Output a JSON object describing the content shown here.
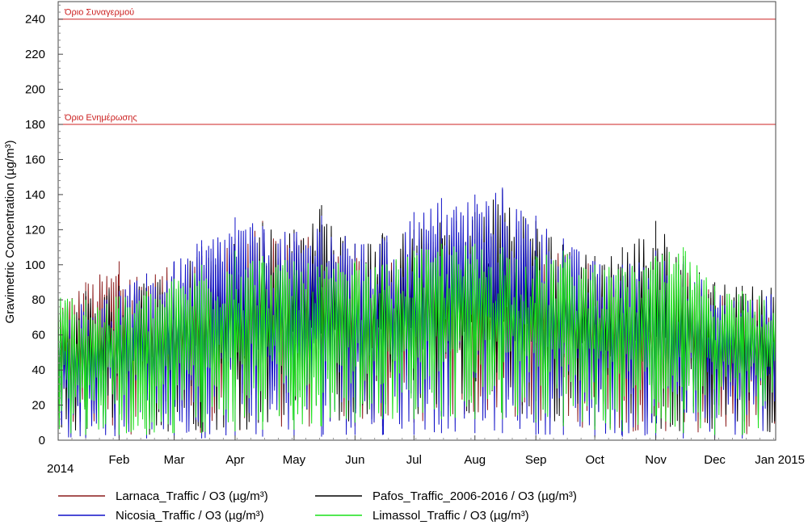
{
  "chart_data": {
    "type": "line",
    "title": "",
    "xlabel": "",
    "ylabel": "Gravimetric Concentration (µg/m³)",
    "ylim": [
      0,
      250
    ],
    "xlim": [
      "2014-01-01",
      "2015-01-01"
    ],
    "y_ticks": [
      0,
      20,
      40,
      60,
      80,
      100,
      120,
      140,
      160,
      180,
      200,
      220,
      240
    ],
    "x_ticks": [
      {
        "date": "2014-02-01",
        "label": "Feb"
      },
      {
        "date": "2014-03-01",
        "label": "Mar"
      },
      {
        "date": "2014-04-01",
        "label": "Apr"
      },
      {
        "date": "2014-05-01",
        "label": "May"
      },
      {
        "date": "2014-06-01",
        "label": "Jun"
      },
      {
        "date": "2014-07-01",
        "label": "Jul"
      },
      {
        "date": "2014-08-01",
        "label": "Aug"
      },
      {
        "date": "2014-09-01",
        "label": "Sep"
      },
      {
        "date": "2014-10-01",
        "label": "Oct"
      },
      {
        "date": "2014-11-01",
        "label": "Nov"
      },
      {
        "date": "2014-12-01",
        "label": "Dec"
      },
      {
        "date": "2015-01-01",
        "label": "Jan 2015"
      }
    ],
    "year_label": "2014",
    "grid": false,
    "legend_position": "bottom",
    "reference_lines": [
      {
        "value": 240,
        "label": "Όριο Συναγερμού",
        "color": "#cc2222"
      },
      {
        "value": 180,
        "label": "Όριο Ενημέρωσης",
        "color": "#cc2222"
      }
    ],
    "series": [
      {
        "name": "Larnaca_Traffic / O3 (µg/m³)",
        "color": "#8b1a1a",
        "x": [
          "2014-01-01",
          "2014-01-15",
          "2014-02-01",
          "2014-02-15",
          "2014-03-01",
          "2014-03-15",
          "2014-04-01",
          "2014-04-15",
          "2014-05-01",
          "2014-05-15",
          "2014-06-01",
          "2014-06-15",
          "2014-07-01",
          "2014-07-15",
          "2014-08-01",
          "2014-08-15",
          "2014-09-01",
          "2014-09-15",
          "2014-10-01",
          "2014-10-15",
          "2014-11-01",
          "2014-11-15",
          "2014-12-01",
          "2014-12-15",
          "2015-01-01"
        ],
        "max": [
          80,
          90,
          102,
          95,
          100,
          105,
          112,
          125,
          118,
          115,
          108,
          105,
          110,
          115,
          112,
          110,
          105,
          108,
          100,
          98,
          95,
          100,
          85,
          80,
          82
        ],
        "min": [
          2,
          3,
          3,
          3,
          3,
          4,
          5,
          6,
          6,
          6,
          8,
          8,
          10,
          12,
          12,
          12,
          10,
          8,
          6,
          5,
          4,
          4,
          3,
          3,
          3
        ]
      },
      {
        "name": "Pafos_Traffic_2006-2016 / O3 (µg/m³)",
        "color": "#000000",
        "x": [
          "2014-01-01",
          "2014-01-15",
          "2014-02-01",
          "2014-02-15",
          "2014-03-01",
          "2014-03-15",
          "2014-04-01",
          "2014-04-15",
          "2014-05-01",
          "2014-05-15",
          "2014-06-01",
          "2014-06-15",
          "2014-07-01",
          "2014-07-15",
          "2014-08-01",
          "2014-08-15",
          "2014-09-01",
          "2014-09-15",
          "2014-10-01",
          "2014-10-15",
          "2014-11-01",
          "2014-11-15",
          "2014-12-01",
          "2014-12-15",
          "2015-01-01"
        ],
        "max": [
          78,
          85,
          88,
          92,
          98,
          108,
          115,
          124,
          120,
          134,
          112,
          118,
          120,
          125,
          130,
          143,
          125,
          112,
          105,
          110,
          125,
          105,
          90,
          88,
          92
        ],
        "min": [
          2,
          2,
          3,
          3,
          4,
          4,
          5,
          6,
          6,
          8,
          10,
          12,
          12,
          15,
          15,
          15,
          12,
          10,
          8,
          6,
          5,
          4,
          3,
          3,
          3
        ]
      },
      {
        "name": "Nicosia_Traffic / O3 (µg/m³)",
        "color": "#1010c8",
        "x": [
          "2014-01-01",
          "2014-01-15",
          "2014-02-01",
          "2014-02-15",
          "2014-03-01",
          "2014-03-15",
          "2014-04-01",
          "2014-04-15",
          "2014-05-01",
          "2014-05-15",
          "2014-06-01",
          "2014-06-15",
          "2014-07-01",
          "2014-07-15",
          "2014-08-01",
          "2014-08-15",
          "2014-09-01",
          "2014-09-15",
          "2014-10-01",
          "2014-10-15",
          "2014-11-01",
          "2014-11-15",
          "2014-12-01",
          "2014-12-15",
          "2015-01-01"
        ],
        "max": [
          72,
          80,
          85,
          95,
          102,
          114,
          127,
          122,
          118,
          128,
          112,
          115,
          130,
          138,
          140,
          144,
          128,
          115,
          102,
          100,
          108,
          102,
          85,
          82,
          85
        ],
        "min": [
          1,
          1,
          1,
          1,
          1,
          1,
          2,
          2,
          2,
          2,
          3,
          3,
          3,
          4,
          4,
          4,
          3,
          3,
          2,
          2,
          1,
          1,
          1,
          1,
          1
        ]
      },
      {
        "name": "Limassol_Traffic / O3 (µg/m³)",
        "color": "#18e018",
        "x": [
          "2014-01-01",
          "2014-01-15",
          "2014-02-01",
          "2014-02-15",
          "2014-03-01",
          "2014-03-15",
          "2014-04-01",
          "2014-04-15",
          "2014-05-01",
          "2014-05-15",
          "2014-06-01",
          "2014-06-15",
          "2014-07-01",
          "2014-07-15",
          "2014-08-01",
          "2014-08-15",
          "2014-09-01",
          "2014-09-15",
          "2014-10-01",
          "2014-10-15",
          "2014-11-01",
          "2014-11-15",
          "2014-12-01",
          "2014-12-15",
          "2015-01-01"
        ],
        "max": [
          86,
          80,
          82,
          85,
          92,
          100,
          108,
          105,
          102,
          100,
          102,
          100,
          108,
          112,
          112,
          110,
          105,
          108,
          100,
          98,
          105,
          110,
          88,
          85,
          90
        ],
        "min": [
          3,
          3,
          3,
          3,
          4,
          4,
          5,
          6,
          6,
          8,
          10,
          12,
          12,
          12,
          12,
          12,
          10,
          8,
          6,
          5,
          4,
          4,
          3,
          3,
          3
        ]
      }
    ]
  }
}
